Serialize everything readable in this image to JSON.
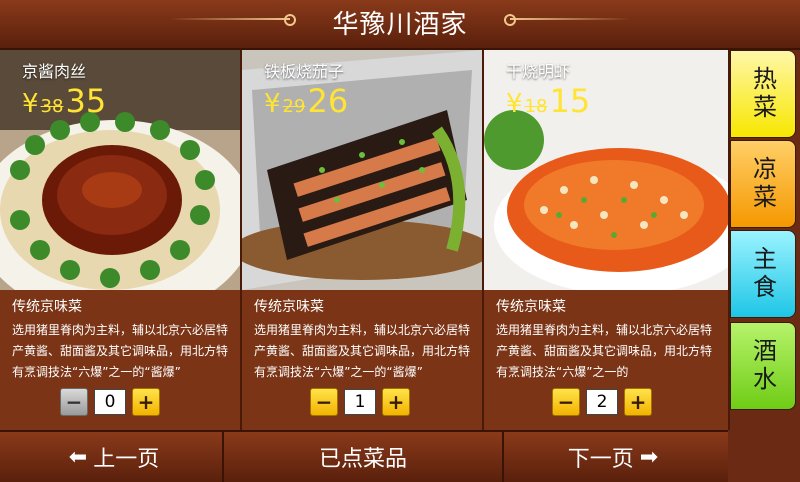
{
  "header": {
    "title": "华豫川酒家"
  },
  "dishes": [
    {
      "name": "京酱肉丝",
      "yen": "¥",
      "old_price": "38",
      "price": "35",
      "category": "传统京味菜",
      "description": "选用猪里脊肉为主料，辅以北京六必居特产黄酱、甜面酱及其它调味品，用北方特有烹调技法“六爆”之一的“酱爆”",
      "quantity": "0"
    },
    {
      "name": "铁板烧茄子",
      "yen": "¥",
      "old_price": "29",
      "price": "26",
      "category": "传统京味菜",
      "description": "选用猪里脊肉为主料，辅以北京六必居特产黄酱、甜面酱及其它调味品，用北方特有烹调技法“六爆”之一的“酱爆”",
      "quantity": "1"
    },
    {
      "name": "干烧明虾",
      "yen": "¥",
      "old_price": "18",
      "price": "15",
      "category": "传统京味菜",
      "description": "选用猪里脊肉为主料，辅以北京六必居特产黄酱、甜面酱及其它调味品，用北方特有烹调技法“六爆”之一的",
      "quantity": "2"
    }
  ],
  "controls": {
    "minus": "−",
    "plus": "+"
  },
  "tabs": [
    "热菜",
    "凉菜",
    "主食",
    "酒水"
  ],
  "footer": {
    "prev": "上一页",
    "ordered": "已点菜品",
    "next": "下一页",
    "prev_arrow": "⬅",
    "next_arrow": "➡"
  }
}
